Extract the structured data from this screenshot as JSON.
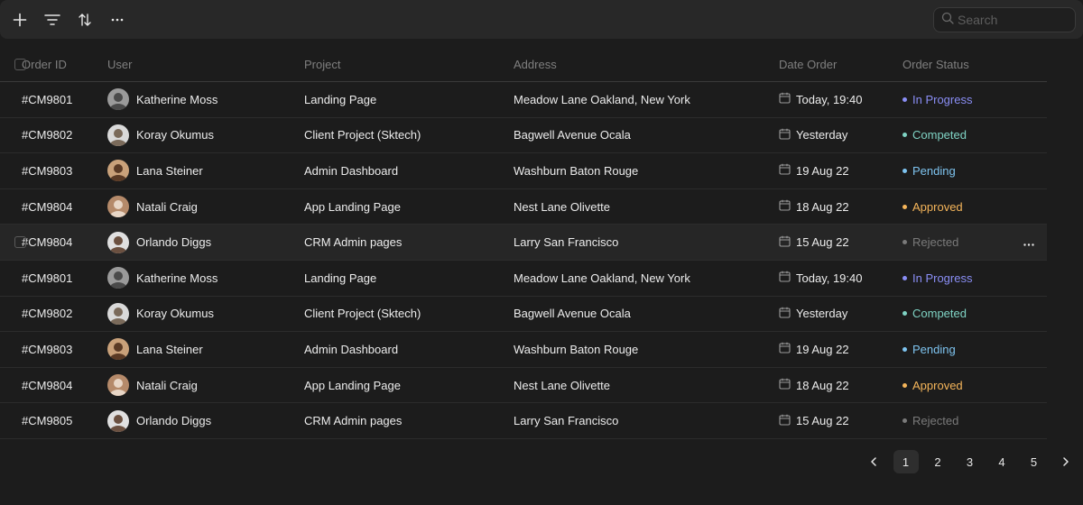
{
  "toolbar": {
    "icons": [
      "plus-icon",
      "filter-icon",
      "sort-icon",
      "more-icon"
    ]
  },
  "search": {
    "placeholder": "Search"
  },
  "columns": {
    "order_id": "Order ID",
    "user": "User",
    "project": "Project",
    "address": "Address",
    "date": "Date Order",
    "status": "Order Status"
  },
  "status_colors": {
    "In Progress": "#8a8ef5",
    "Competed": "#7fd3c4",
    "Pending": "#7ec4f0",
    "Approved": "#f5b55a",
    "Rejected": "#7a7a7a"
  },
  "rows": [
    {
      "id": "#CM9801",
      "user": "Katherine Moss",
      "project": "Landing Page",
      "address": "Meadow Lane Oakland, New York",
      "date": "Today, 19:40",
      "status": "In Progress"
    },
    {
      "id": "#CM9802",
      "user": "Koray Okumus",
      "project": "Client Project (Sktech)",
      "address": "Bagwell Avenue Ocala",
      "date": "Yesterday",
      "status": "Competed"
    },
    {
      "id": "#CM9803",
      "user": "Lana Steiner",
      "project": "Admin Dashboard",
      "address": "Washburn Baton Rouge",
      "date": "19 Aug 22",
      "status": "Pending"
    },
    {
      "id": "#CM9804",
      "user": "Natali Craig",
      "project": "App Landing Page",
      "address": "Nest Lane Olivette",
      "date": "18 Aug 22",
      "status": "Approved"
    },
    {
      "id": "#CM9804",
      "user": "Orlando Diggs",
      "project": "CRM Admin pages",
      "address": "Larry San Francisco",
      "date": "15 Aug 22",
      "status": "Rejected"
    },
    {
      "id": "#CM9801",
      "user": "Katherine Moss",
      "project": "Landing Page",
      "address": "Meadow Lane Oakland, New York",
      "date": "Today, 19:40",
      "status": "In Progress"
    },
    {
      "id": "#CM9802",
      "user": "Koray Okumus",
      "project": "Client Project (Sktech)",
      "address": "Bagwell Avenue Ocala",
      "date": "Yesterday",
      "status": "Competed"
    },
    {
      "id": "#CM9803",
      "user": "Lana Steiner",
      "project": "Admin Dashboard",
      "address": "Washburn Baton Rouge",
      "date": "19 Aug 22",
      "status": "Pending"
    },
    {
      "id": "#CM9804",
      "user": "Natali Craig",
      "project": "App Landing Page",
      "address": "Nest Lane Olivette",
      "date": "18 Aug 22",
      "status": "Approved"
    },
    {
      "id": "#CM9805",
      "user": "Orlando Diggs",
      "project": "CRM Admin pages",
      "address": "Larry San Francisco",
      "date": "15 Aug 22",
      "status": "Rejected"
    }
  ],
  "hovered_row_index": 4,
  "pagination": {
    "pages": [
      "1",
      "2",
      "3",
      "4",
      "5"
    ],
    "current": "1",
    "prev_icon": "chevron-left-icon",
    "next_icon": "chevron-right-icon"
  }
}
